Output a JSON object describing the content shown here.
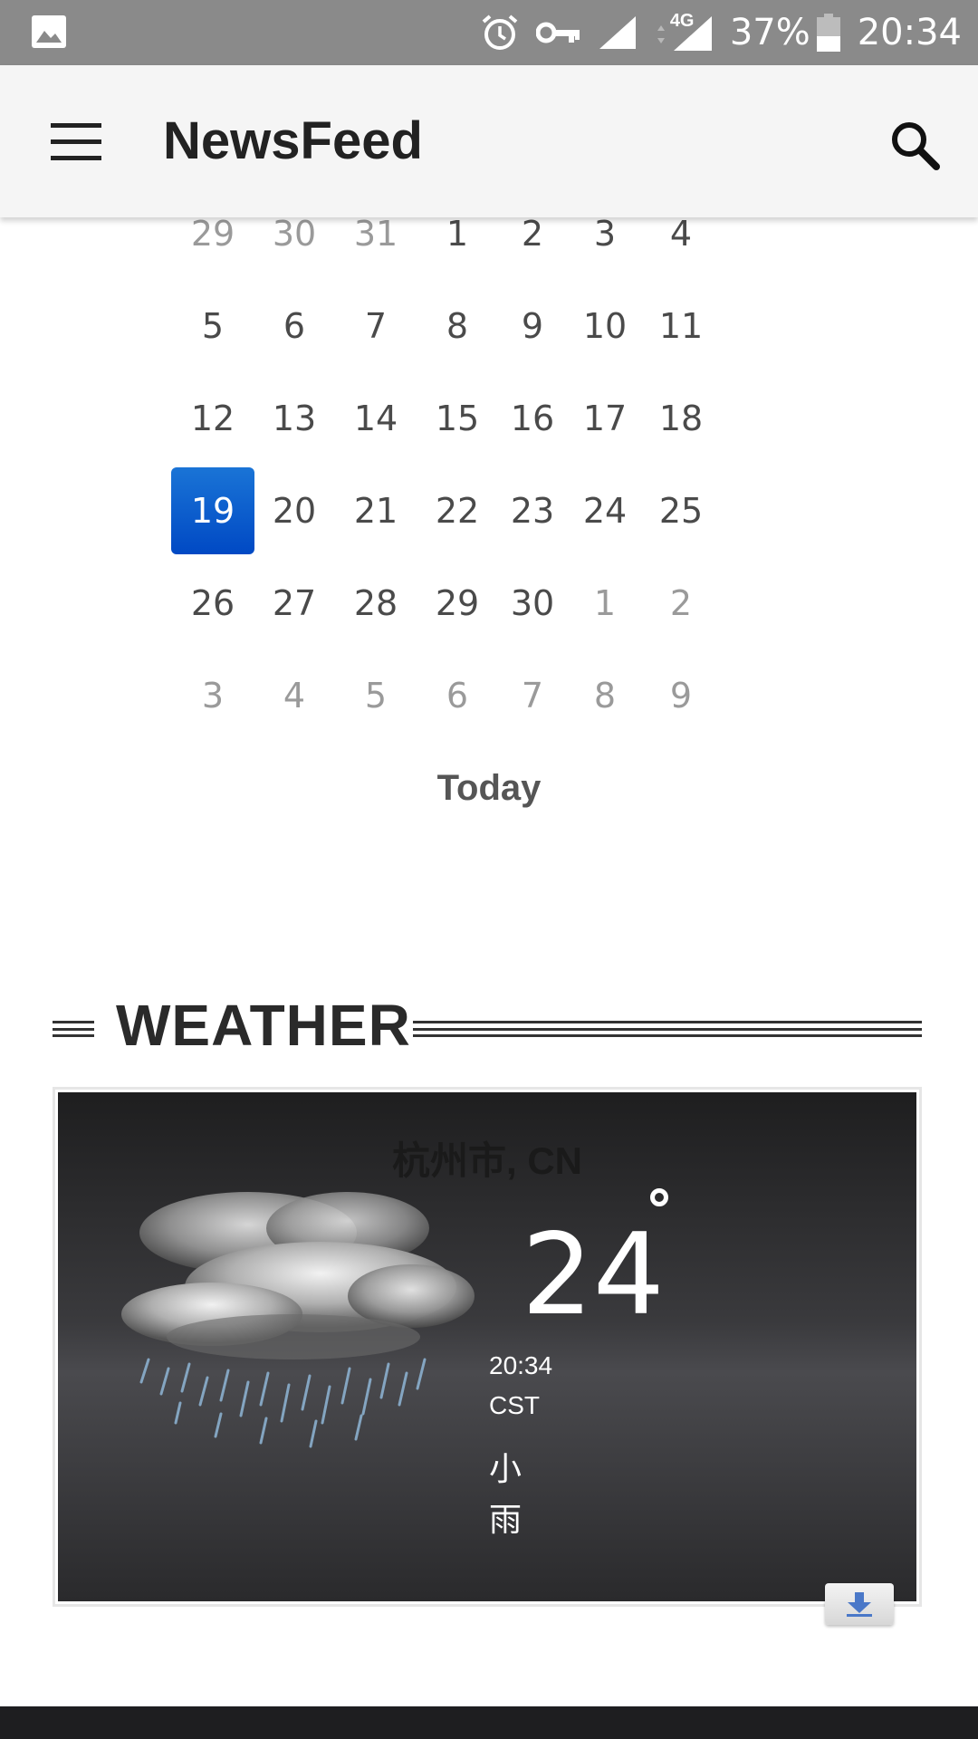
{
  "status_bar": {
    "battery": "37%",
    "time": "20:34",
    "network": "4G",
    "icons": [
      "image-icon",
      "alarm-icon",
      "vpn-key-icon",
      "signal-icon",
      "signal-4g-icon",
      "battery-icon"
    ]
  },
  "app_bar": {
    "title": "NewsFeed",
    "menu_icon": "menu-icon",
    "search_icon": "search-icon"
  },
  "calendar": {
    "weeks": [
      [
        "29",
        "30",
        "31",
        "1",
        "2",
        "3",
        "4"
      ],
      [
        "5",
        "6",
        "7",
        "8",
        "9",
        "10",
        "11"
      ],
      [
        "12",
        "13",
        "14",
        "15",
        "16",
        "17",
        "18"
      ],
      [
        "19",
        "20",
        "21",
        "22",
        "23",
        "24",
        "25"
      ],
      [
        "26",
        "27",
        "28",
        "29",
        "30",
        "1",
        "2"
      ],
      [
        "3",
        "4",
        "5",
        "6",
        "7",
        "8",
        "9"
      ]
    ],
    "selected": "19",
    "today_label": "Today"
  },
  "weather": {
    "section_title": "WEATHER",
    "city": "杭州市, CN",
    "temperature": "24",
    "time": "20:34",
    "timezone": "CST",
    "description": "小雨",
    "condition_icon": "light-rain-cloud-icon",
    "download_icon": "download-icon"
  }
}
